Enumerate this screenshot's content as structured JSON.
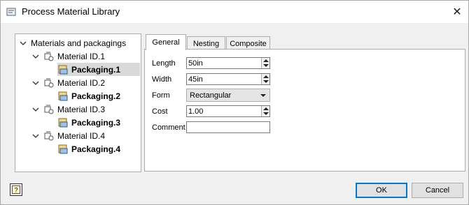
{
  "window": {
    "title": "Process Material Library"
  },
  "tree": {
    "root_label": "Materials and packagings",
    "materials": [
      {
        "label": "Material ID.1",
        "packaging": "Packaging.1"
      },
      {
        "label": "Material ID.2",
        "packaging": "Packaging.2"
      },
      {
        "label": "Material ID.3",
        "packaging": "Packaging.3"
      },
      {
        "label": "Material ID.4",
        "packaging": "Packaging.4"
      }
    ],
    "selected": "Packaging.1"
  },
  "tabs": [
    {
      "label": "General"
    },
    {
      "label": "Nesting"
    },
    {
      "label": "Composite"
    }
  ],
  "active_tab": "General",
  "form": {
    "length": {
      "label": "Length",
      "value": "50in"
    },
    "width": {
      "label": "Width",
      "value": "45in"
    },
    "form": {
      "label": "Form",
      "value": "Rectangular"
    },
    "cost": {
      "label": "Cost",
      "value": "1.00"
    },
    "comment": {
      "label": "Comment",
      "value": ""
    }
  },
  "buttons": {
    "ok": "OK",
    "cancel": "Cancel"
  },
  "icons": {
    "title": "material-library-icon",
    "help": "help-icon",
    "close": "close-icon",
    "node": "material-node-icon",
    "packaging": "packaging-icon"
  },
  "colors": {
    "selection": "#d9d9d9",
    "default_button_border": "#0078d7"
  }
}
